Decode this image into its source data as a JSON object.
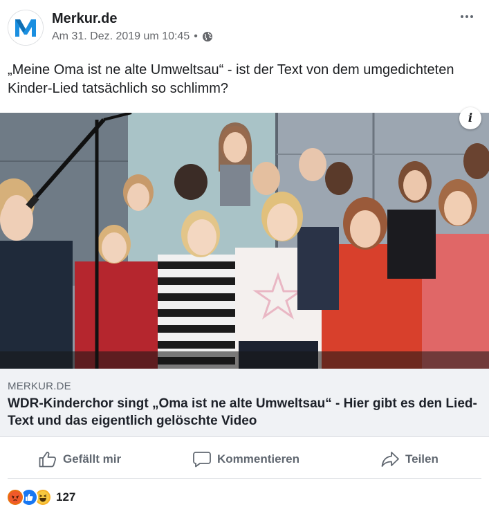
{
  "post": {
    "page_name": "Merkur.de",
    "timestamp": "Am 31. Dez. 2019 um 10:45",
    "separator": "•",
    "audience_icon": "globe-icon",
    "more_icon": "more-dots-icon",
    "text": "„Meine Oma ist ne alte Umweltsau“ - ist der Text von dem umgedichteten Kinder-Lied tatsächlich so schlimm?"
  },
  "link_preview": {
    "info_label": "i",
    "domain": "MERKUR.DE",
    "title": "WDR-Kinderchor singt „Oma ist ne alte Umweltsau“ - Hier gibt es den Lied-Text und das eigentlich gelöschte Video"
  },
  "actions": {
    "like_label": "Gefällt mir",
    "comment_label": "Kommentieren",
    "share_label": "Teilen"
  },
  "reactions": {
    "icons": [
      "angry-reaction-icon",
      "like-reaction-icon",
      "haha-reaction-icon"
    ],
    "count": "127"
  },
  "colors": {
    "brand": "#1a8fe0",
    "text_primary": "#1c1e21",
    "text_secondary": "#606770",
    "link_box_bg": "#f0f2f5"
  }
}
